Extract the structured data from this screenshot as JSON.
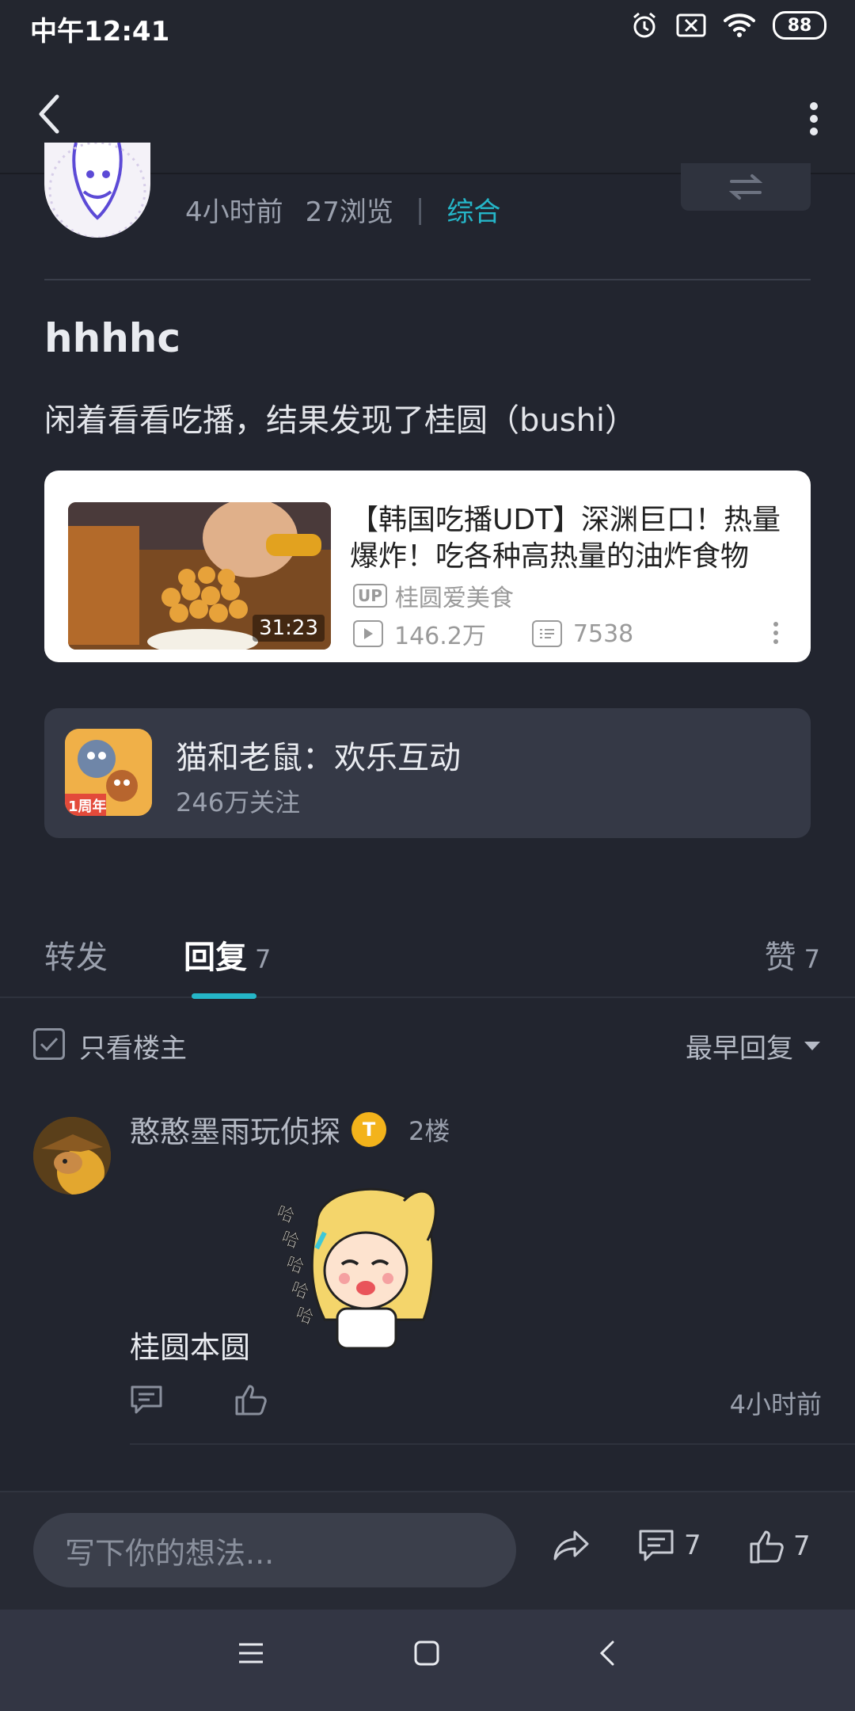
{
  "status_bar": {
    "time": "中午12:41",
    "battery": "88"
  },
  "post": {
    "meta_time": "4小时前",
    "meta_views": "27浏览",
    "meta_separator": "|",
    "category": "综合",
    "title": "hhhhc",
    "body": "闲着看看吃播，结果发现了桂圆（bushi）"
  },
  "video": {
    "title": "【韩国吃播UDT】深渊巨口！热量爆炸！吃各种高热量的油炸食物",
    "duration": "31:23",
    "up_tag": "UP",
    "uploader": "桂圆爱美食",
    "plays": "146.2万",
    "danmaku": "7538"
  },
  "game": {
    "name": "猫和老鼠：欢乐互动",
    "followers": "246万关注",
    "icon_badge": "1周年"
  },
  "tabs": {
    "forward": "转发",
    "reply": "回复",
    "reply_count": "7",
    "like": "赞",
    "like_count": "7"
  },
  "filter": {
    "only_op": "只看楼主",
    "sort": "最早回复"
  },
  "comment": {
    "user": "憨憨墨雨玩侦探",
    "badge": "T",
    "floor": "2楼",
    "text": "桂圆本圆",
    "time": "4小时前"
  },
  "bottom_bar": {
    "placeholder": "写下你的想法...",
    "comment_count": "7",
    "like_count": "7"
  },
  "colors": {
    "accent": "#25b6c8",
    "background": "#22252f"
  }
}
